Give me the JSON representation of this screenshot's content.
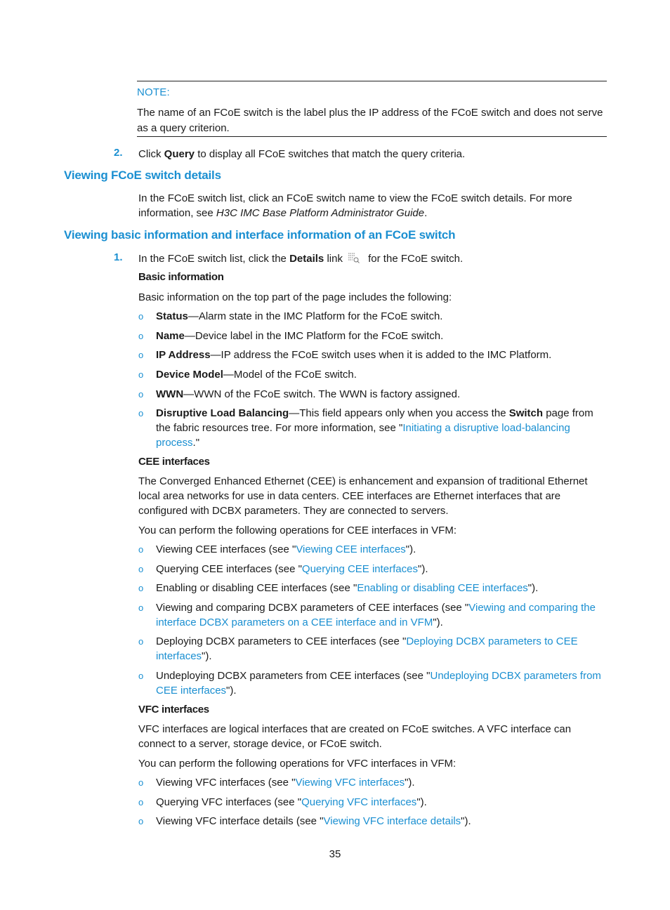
{
  "note": {
    "label": "NOTE:",
    "text": "The name of an FCoE switch is the label plus the IP address of the FCoE switch and does not serve as a query criterion."
  },
  "step2": {
    "number": "2.",
    "pre": "Click ",
    "bold": "Query",
    "post": " to display all FCoE switches that match the query criteria."
  },
  "section1": {
    "heading": "Viewing FCoE switch details",
    "text_pre": "In the FCoE switch list, click an FCoE switch name to view the FCoE switch details. For more information, see ",
    "text_italic": "H3C IMC Base Platform Administrator Guide",
    "text_post": "."
  },
  "section2": {
    "heading": "Viewing basic information and interface information of an FCoE switch",
    "step1": {
      "number": "1.",
      "pre": "In the FCoE switch list, click the ",
      "bold": "Details",
      "mid": " link",
      "icon": "details-icon",
      "post": " for the FCoE switch."
    },
    "basic": {
      "heading": "Basic information",
      "intro": "Basic information on the top part of the page includes the following:",
      "items": [
        {
          "term": "Status",
          "desc": "—Alarm state in the IMC Platform for the FCoE switch."
        },
        {
          "term": "Name",
          "desc": "—Device label in the IMC Platform for the FCoE switch."
        },
        {
          "term": "IP Address",
          "desc": "—IP address the FCoE switch uses when it is added to the IMC Platform."
        },
        {
          "term": "Device Model",
          "desc": "—Model of the FCoE switch."
        },
        {
          "term": "WWN",
          "desc": "—WWN of the FCoE switch. The WWN is factory assigned."
        },
        {
          "term": "Disruptive Load Balancing",
          "desc_pre": "—This field appears only when you access the ",
          "desc_bold": "Switch",
          "desc_mid": " page from the fabric resources tree. For more information, see \"",
          "link": "Initiating a disruptive load-balancing process",
          "desc_post": ".\""
        }
      ]
    },
    "cee": {
      "heading": "CEE interfaces",
      "intro": "The Converged Enhanced Ethernet (CEE) is enhancement and expansion of traditional Ethernet local area networks for use in data centers. CEE interfaces are Ethernet interfaces that are configured with DCBX parameters. They are connected to servers.",
      "ops_intro": "You can perform the following operations for CEE interfaces in VFM:",
      "items": [
        {
          "pre": "Viewing CEE interfaces (see \"",
          "link": "Viewing CEE interfaces",
          "post": "\")."
        },
        {
          "pre": "Querying CEE interfaces (see \"",
          "link": "Querying CEE interfaces",
          "post": "\")."
        },
        {
          "pre": "Enabling or disabling CEE interfaces (see \"",
          "link": "Enabling or disabling CEE interfaces",
          "post": "\")."
        },
        {
          "pre": "Viewing and comparing DCBX parameters of CEE interfaces (see \"",
          "link": "Viewing and comparing the interface DCBX parameters on a CEE interface and in VFM",
          "post": "\")."
        },
        {
          "pre": "Deploying DCBX parameters to CEE interfaces (see \"",
          "link": "Deploying DCBX parameters to CEE interfaces",
          "post": "\")."
        },
        {
          "pre": "Undeploying DCBX parameters from CEE interfaces (see \"",
          "link": "Undeploying DCBX parameters from CEE interfaces",
          "post": "\")."
        }
      ]
    },
    "vfc": {
      "heading": "VFC interfaces",
      "intro": "VFC interfaces are logical interfaces that are created on FCoE switches. A VFC interface can connect to a server, storage device, or FCoE switch.",
      "ops_intro": "You can perform the following operations for VFC interfaces in VFM:",
      "items": [
        {
          "pre": "Viewing VFC interfaces (see \"",
          "link": "Viewing VFC interfaces",
          "post": "\")."
        },
        {
          "pre": "Querying VFC interfaces (see \"",
          "link": "Querying VFC interfaces",
          "post": "\")."
        },
        {
          "pre": "Viewing VFC interface details (see \"",
          "link": "Viewing VFC interface details",
          "post": "\")."
        }
      ]
    }
  },
  "bullet_mark": "o",
  "page_number": "35",
  "colors": {
    "accent": "#1a8fd1",
    "text": "#1a1a1a"
  }
}
